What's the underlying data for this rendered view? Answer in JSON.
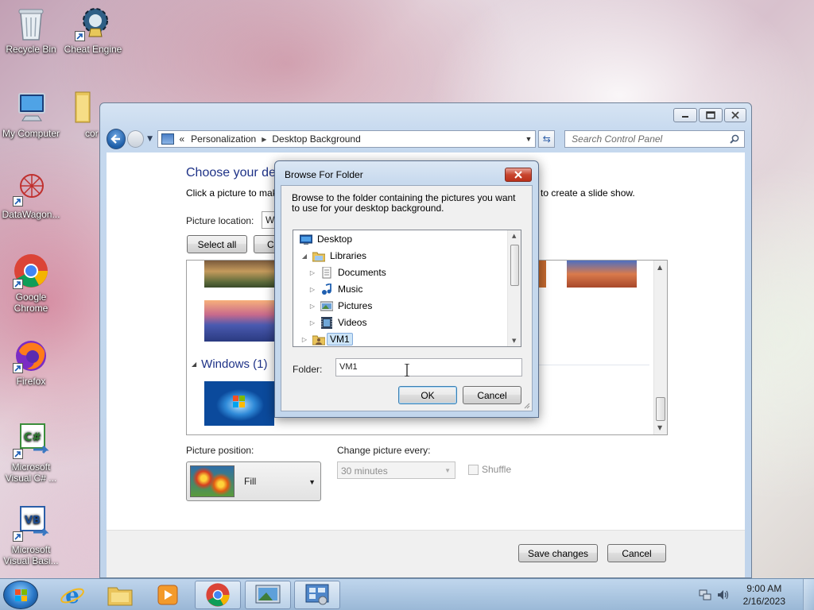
{
  "desktop": {
    "icons": [
      {
        "label": "Recycle Bin"
      },
      {
        "label": "Cheat Engine"
      },
      {
        "label": "My Computer"
      },
      {
        "label": "cor"
      },
      {
        "label": "DataWagon..."
      },
      {
        "label": "Google Chrome"
      },
      {
        "label": "Firefox"
      },
      {
        "label": "Microsoft Visual C# ..."
      },
      {
        "label": "Microsoft Visual Basi..."
      }
    ]
  },
  "window": {
    "breadcrumb": {
      "chevrons": "«",
      "items": [
        "Personalization",
        "Desktop Background"
      ]
    },
    "search_placeholder": "Search Control Panel",
    "content": {
      "title": "Choose your des",
      "description_left": "Click a picture to mak",
      "description_right": "to create a slide show.",
      "picture_location_label": "Picture location:",
      "picture_location_value": "W",
      "select_all_label": "Select all",
      "clear_all_label": "Cl",
      "group_header": "Windows (1)",
      "picture_position_label": "Picture position:",
      "picture_position_value": "Fill",
      "change_picture_label": "Change picture every:",
      "change_picture_value": "30 minutes",
      "shuffle_label": "Shuffle"
    },
    "footer": {
      "save_label": "Save changes",
      "cancel_label": "Cancel"
    }
  },
  "dialog": {
    "title": "Browse For Folder",
    "instructions": "Browse to the folder containing the pictures you want to use for your desktop background.",
    "tree": [
      {
        "label": "Desktop",
        "icon": "desktop-icon",
        "level": 0,
        "expander": ""
      },
      {
        "label": "Libraries",
        "icon": "libraries-icon",
        "level": 1,
        "expander": "▲"
      },
      {
        "label": "Documents",
        "icon": "documents-icon",
        "level": 2,
        "expander": "▷"
      },
      {
        "label": "Music",
        "icon": "music-icon",
        "level": 2,
        "expander": "▷"
      },
      {
        "label": "Pictures",
        "icon": "pictures-icon",
        "level": 2,
        "expander": "▷"
      },
      {
        "label": "Videos",
        "icon": "videos-icon",
        "level": 2,
        "expander": "▷"
      },
      {
        "label": "VM1",
        "icon": "user-folder-icon",
        "level": 1,
        "expander": "▷",
        "selected": true
      }
    ],
    "folder_label": "Folder:",
    "folder_value": "VM1",
    "ok_label": "OK",
    "cancel_label": "Cancel"
  },
  "taskbar": {
    "clock_time": "9:00 AM",
    "clock_date": "2/16/2023",
    "apps": [
      "internet-explorer-icon",
      "explorer-icon",
      "media-player-icon",
      "chrome-icon",
      "desktop-background-icon",
      "control-panel-icon"
    ]
  },
  "colors": {
    "accent_blue": "#1e3287",
    "selection": "#cce4f7",
    "close_red": "#c8452f"
  }
}
